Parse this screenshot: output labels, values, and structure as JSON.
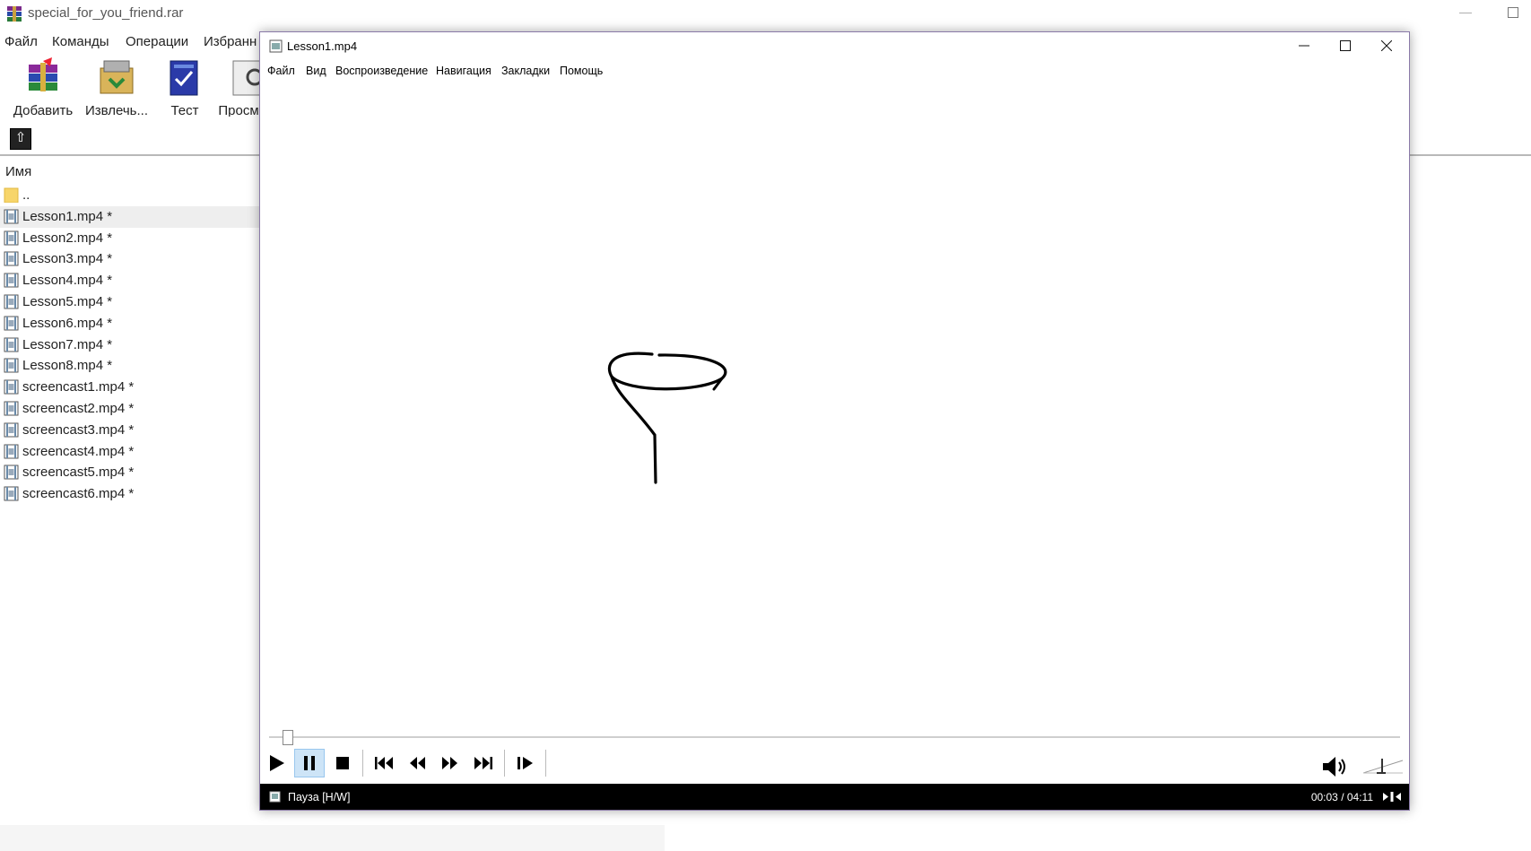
{
  "archiver": {
    "title": "special_for_you_friend.rar",
    "menu": [
      "Файл",
      "Команды",
      "Операции",
      "Избранн"
    ],
    "toolbar": [
      {
        "label": "Добавить",
        "icon": "add-archive-icon"
      },
      {
        "label": "Извлечь...",
        "icon": "extract-icon"
      },
      {
        "label": "Тест",
        "icon": "test-icon"
      },
      {
        "label": "Просм",
        "icon": "view-icon"
      }
    ],
    "column_header": "Имя",
    "parent_folder": "..",
    "files": [
      "Lesson1.mp4 *",
      "Lesson2.mp4 *",
      "Lesson3.mp4 *",
      "Lesson4.mp4 *",
      "Lesson5.mp4 *",
      "Lesson6.mp4 *",
      "Lesson7.mp4 *",
      "Lesson8.mp4 *",
      "screencast1.mp4 *",
      "screencast2.mp4 *",
      "screencast3.mp4 *",
      "screencast4.mp4 *",
      "screencast5.mp4 *",
      "screencast6.mp4 *"
    ],
    "selected_file": "Lesson1.mp4 *"
  },
  "player": {
    "title": "Lesson1.mp4",
    "menu": [
      "Файл",
      "Вид",
      "Воспроизведение",
      "Навигация",
      "Закладки",
      "Помощь"
    ],
    "status": "Пауза [H/W]",
    "time": "00:03 / 04:11",
    "progress_fraction": 0.012,
    "colors": {
      "status_bg": "#000000",
      "active_button": "#cde4f7",
      "window_border": "#8a7aa8"
    }
  }
}
